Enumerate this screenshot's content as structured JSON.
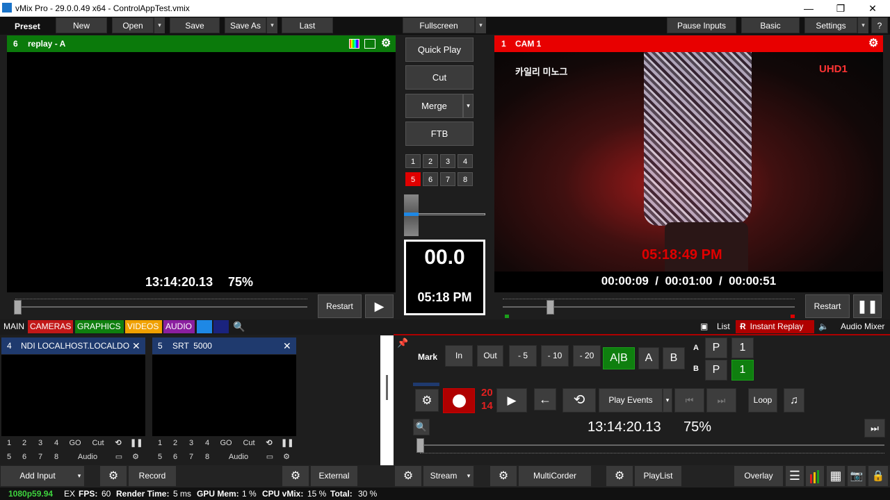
{
  "window": {
    "title": "vMix Pro - 29.0.0.49 x64 - ControlAppTest.vmix",
    "minimize": "—",
    "maximize": "❐",
    "close": "✕"
  },
  "menu": {
    "preset": "Preset",
    "new": "New",
    "open": "Open",
    "save": "Save",
    "save_as": "Save As",
    "last": "Last",
    "fullscreen": "Fullscreen",
    "pause_inputs": "Pause Inputs",
    "basic": "Basic",
    "settings": "Settings",
    "help": "?"
  },
  "preview": {
    "number": "6",
    "name": "replay - A",
    "timecode": "13:14:20.13",
    "zoom": "75%",
    "restart": "Restart"
  },
  "program": {
    "number": "1",
    "name": "CAM 1",
    "overlay_kr": "카일리 미노그",
    "channel_logo": "UHD1",
    "overlay_clock": "05:18:49 PM",
    "time_display": "00:00:09  /  00:01:00  /  00:00:51",
    "restart": "Restart"
  },
  "transitions": {
    "quick_play": "Quick Play",
    "cut": "Cut",
    "merge": "Merge",
    "ftb": "FTB",
    "numbers": [
      "1",
      "2",
      "3",
      "4",
      "5",
      "6",
      "7",
      "8"
    ],
    "active": "5",
    "countdown": "00.0",
    "clock": "05:18 PM"
  },
  "tabs": {
    "main": "MAIN",
    "cameras": "CAMERAS",
    "graphics": "GRAPHICS",
    "videos": "VIDEOS",
    "audio": "AUDIO"
  },
  "right_tabs": {
    "list": "List",
    "instant_replay": "Instant Replay",
    "audio_mixer": "Audio Mixer"
  },
  "inputs": [
    {
      "number": "4",
      "name": "NDI LOCALHOST.LOCALDOI",
      "row1": [
        "1",
        "2",
        "3",
        "4",
        "GO",
        "Cut"
      ],
      "row2": [
        "5",
        "6",
        "7",
        "8",
        "Audio"
      ]
    },
    {
      "number": "5",
      "name": "SRT  5000",
      "row1": [
        "1",
        "2",
        "3",
        "4",
        "GO",
        "Cut"
      ],
      "row2": [
        "5",
        "6",
        "7",
        "8",
        "Audio"
      ]
    }
  ],
  "replay": {
    "mark": "Mark",
    "in": "In",
    "out": "Out",
    "m5": "- 5",
    "m10": "- 10",
    "m20": "- 20",
    "ab": "A|B",
    "a": "A",
    "b": "B",
    "label_a": "A",
    "label_b": "B",
    "p": "P",
    "one": "1",
    "rec_num1": "20",
    "rec_num2": "14",
    "play_events": "Play Events",
    "loop": "Loop",
    "timecode": "13:14:20.13",
    "zoom": "75%"
  },
  "bottom": {
    "add_input": "Add Input",
    "record": "Record",
    "external": "External",
    "stream": "Stream",
    "multicorder": "MultiCorder",
    "playlist": "PlayList",
    "overlay": "Overlay"
  },
  "status": {
    "format": "1080p59.94",
    "ex": "EX",
    "fps_label": "FPS:",
    "fps": "60",
    "render_label": "Render Time:",
    "render": "5 ms",
    "gpu_label": "GPU Mem:",
    "gpu": "1 %",
    "cpu_label": "CPU vMix:",
    "cpu": "15 %",
    "total_label": "Total:",
    "total": "30 %"
  },
  "colors": {
    "preview_green": "#0b7a0b",
    "program_red": "#e80000",
    "tab_cameras": "#c21818",
    "tab_graphics": "#0f7f0f",
    "tab_videos": "#f0a000",
    "tab_audio": "#8a1f9f",
    "replay_red": "#b00000"
  }
}
